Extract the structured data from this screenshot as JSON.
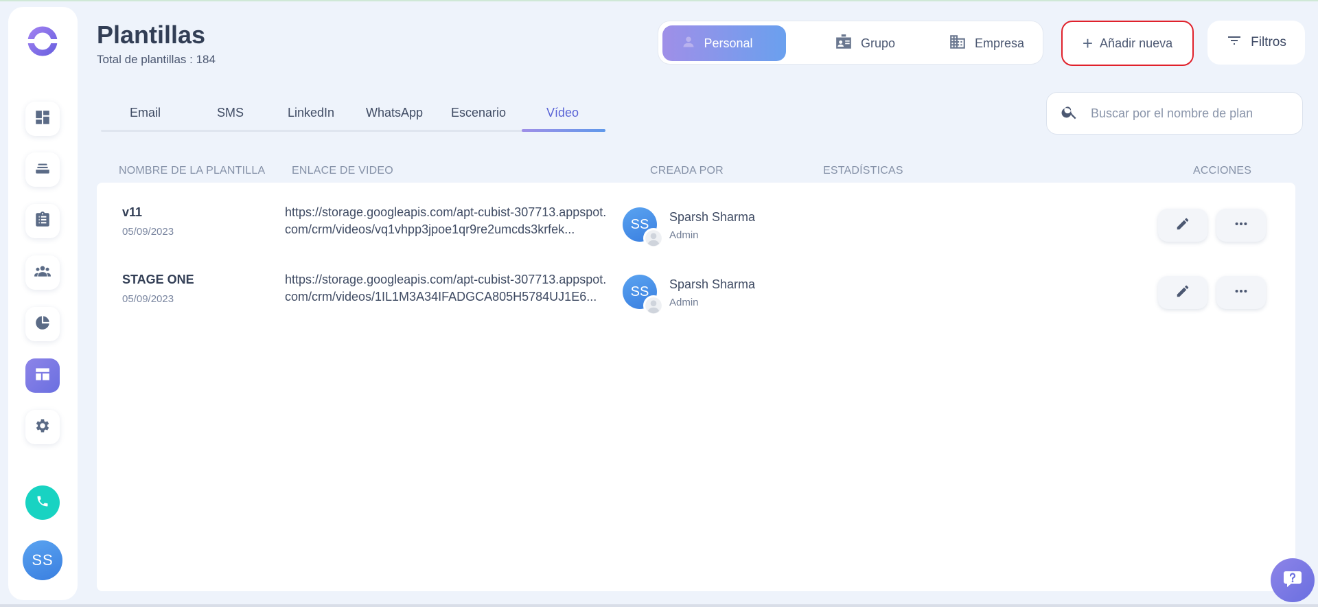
{
  "header": {
    "title": "Plantillas",
    "subtitle": "Total de plantillas : 184"
  },
  "scope": {
    "options": [
      {
        "label": "Personal",
        "icon": "user-icon",
        "active": true
      },
      {
        "label": "Grupo",
        "icon": "id-card-icon",
        "active": false
      },
      {
        "label": "Empresa",
        "icon": "building-icon",
        "active": false
      }
    ]
  },
  "actions": {
    "add_label": "Añadir nueva",
    "filter_label": "Filtros"
  },
  "tabs": [
    {
      "label": "Email",
      "active": false
    },
    {
      "label": "SMS",
      "active": false
    },
    {
      "label": "LinkedIn",
      "active": false
    },
    {
      "label": "WhatsApp",
      "active": false
    },
    {
      "label": "Escenario",
      "active": false
    },
    {
      "label": "Vídeo",
      "active": true
    }
  ],
  "search": {
    "placeholder": "Buscar por el nombre de plan",
    "value": ""
  },
  "table": {
    "columns": [
      "NOMBRE DE LA PLANTILLA",
      "ENLACE DE VIDEO",
      "CREADA POR",
      "ESTADÍSTICAS",
      "ACCIONES"
    ],
    "rows": [
      {
        "name": "v11",
        "date": "05/09/2023",
        "link": "https://storage.googleapis.com/apt-cubist-307713.appspot.com/crm/videos/vq1vhpp3jpoe1qr9re2umcds3krfek...",
        "creator_initials": "SS",
        "creator_name": "Sparsh Sharma",
        "creator_role": "Admin"
      },
      {
        "name": "STAGE ONE",
        "date": "05/09/2023",
        "link": "https://storage.googleapis.com/apt-cubist-307713.appspot.com/crm/videos/1IL1M3A34IFADGCA805H5784UJ1E6...",
        "creator_initials": "SS",
        "creator_name": "Sparsh Sharma",
        "creator_role": "Admin"
      }
    ]
  },
  "sidebar": {
    "items": [
      {
        "icon": "dashboard-icon",
        "active": false
      },
      {
        "icon": "inbox-stack-icon",
        "active": false
      },
      {
        "icon": "clipboard-icon",
        "active": false
      },
      {
        "icon": "people-icon",
        "active": false
      },
      {
        "icon": "pie-chart-icon",
        "active": false
      },
      {
        "icon": "templates-icon",
        "active": true
      },
      {
        "icon": "gear-icon",
        "active": false
      }
    ],
    "user_initials": "SS"
  },
  "colors": {
    "accent": "#6a6fe0",
    "highlight_border": "#e0212b",
    "phone": "#18d3c2",
    "avatar": "#4a90e8"
  }
}
